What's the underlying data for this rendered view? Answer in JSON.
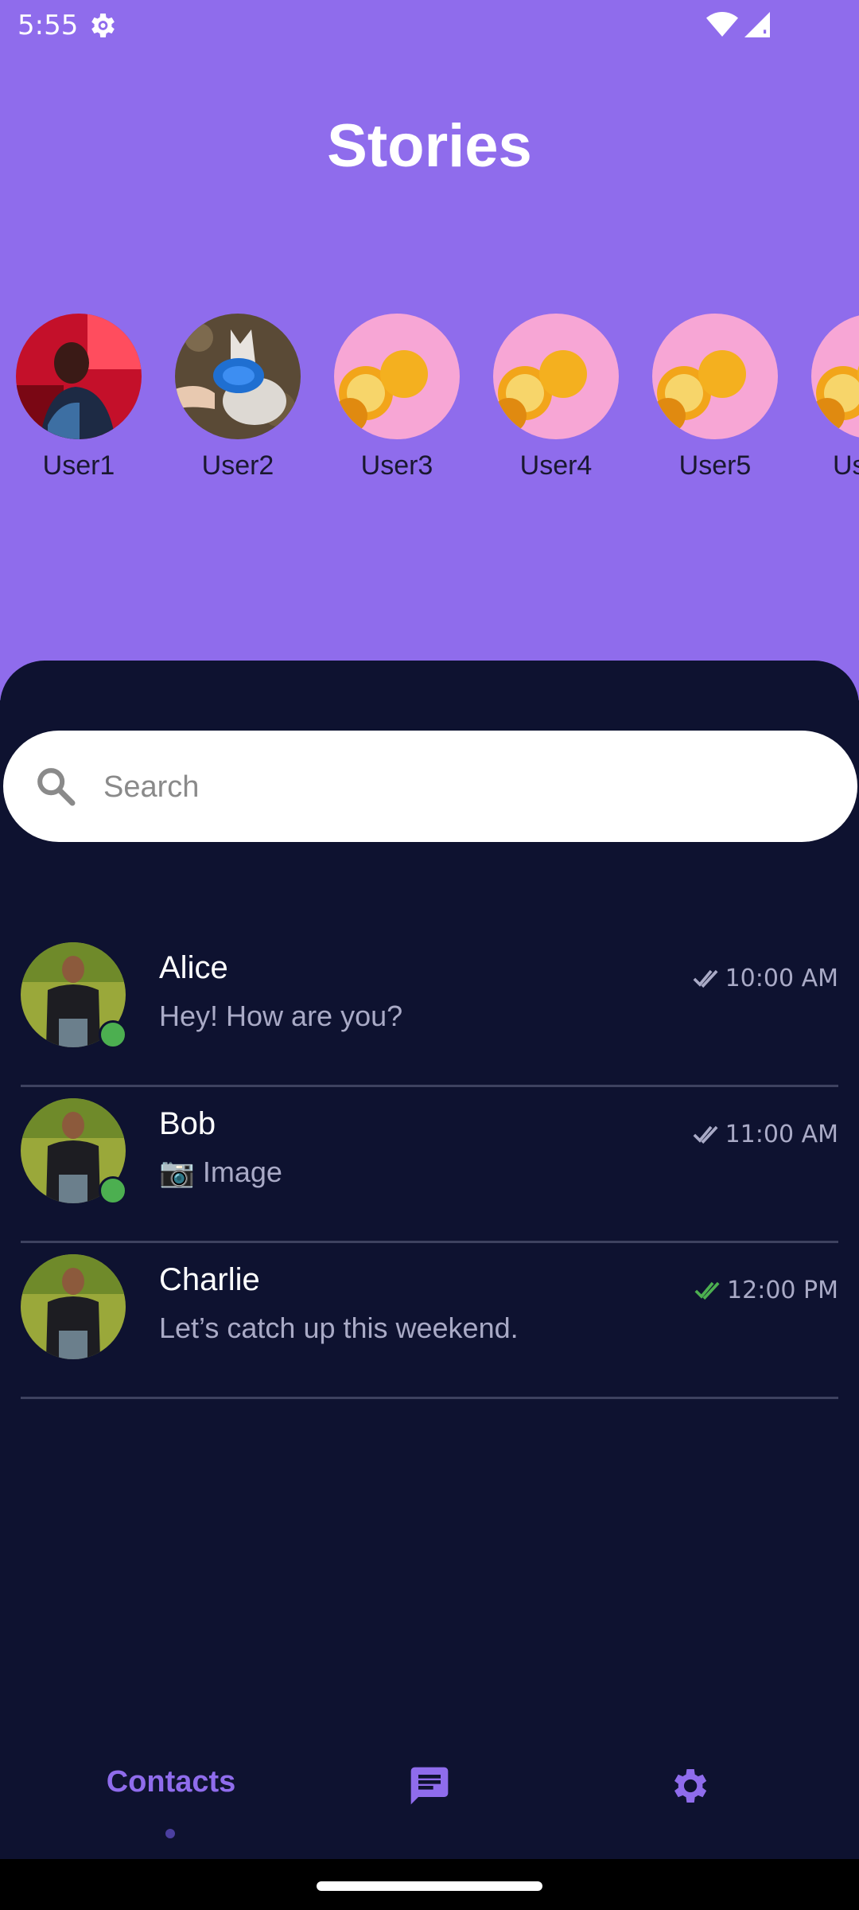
{
  "status_bar": {
    "time": "5:55",
    "icons": [
      "settings-gear-icon",
      "wifi-icon",
      "cell-signal-icon"
    ]
  },
  "header": {
    "title": "Stories"
  },
  "stories": [
    {
      "label": "User1",
      "image": "man-red-light-photo"
    },
    {
      "label": "User2",
      "image": "dog-frisbee-photo"
    },
    {
      "label": "User3",
      "image": "lemons-pink-photo"
    },
    {
      "label": "User4",
      "image": "lemons-pink-photo"
    },
    {
      "label": "User5",
      "image": "lemons-pink-photo"
    },
    {
      "label": "Us",
      "image": "lemons-pink-photo"
    }
  ],
  "search": {
    "placeholder": "Search",
    "value": ""
  },
  "chats": [
    {
      "name": "Alice",
      "message": "Hey! How are you?",
      "time": "10:00 AM",
      "online": true,
      "read_status": "delivered"
    },
    {
      "name": "Bob",
      "message": "📷 Image",
      "time": "11:00 AM",
      "online": true,
      "read_status": "delivered"
    },
    {
      "name": "Charlie",
      "message": "Let’s catch up this weekend.",
      "time": "12:00 PM",
      "online": false,
      "read_status": "read"
    }
  ],
  "bottom_nav": {
    "contacts_label": "Contacts",
    "items": [
      "contacts",
      "chat-icon",
      "settings-icon"
    ],
    "active": "contacts"
  },
  "colors": {
    "accent": "#8f6cec",
    "background": "#0e1230",
    "online": "#4caf50",
    "read_check": "#4caf50",
    "delivered_check": "#a9aac6"
  }
}
